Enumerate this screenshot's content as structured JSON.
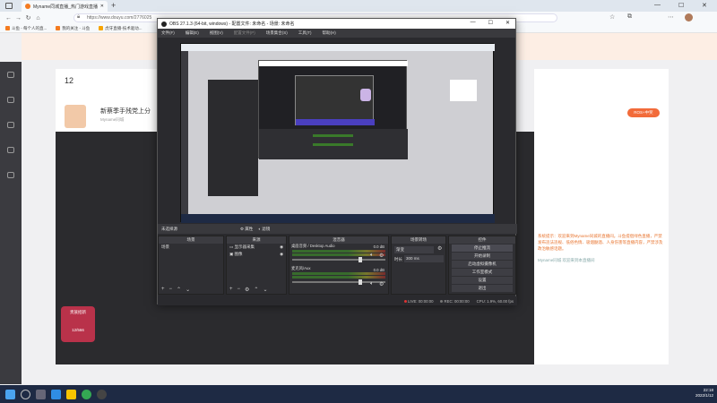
{
  "browser": {
    "tab_title": "Myname同城直播_热门游戏直播",
    "new_tab": "+",
    "address": "https://www.douyu.com/2776025",
    "favorites": [
      "斗鱼 - 每个人的直...",
      "我的关注 - 斗鱼",
      "虎牙直播-技术驱动..."
    ],
    "fav_colors": [
      "#f47b20",
      "#f47b20",
      "#f7a400"
    ]
  },
  "page": {
    "room_number": "12",
    "room_title": "新蔡季手残党上分",
    "host_name": "Myname同城",
    "follow_label": "+ 关注",
    "right_action": "ROS+中奖",
    "chat_notice": "系统提示：欢迎来到Myname同城的直播间。斗鱼提倡绿色直播，严禁发布违法违规、低俗色情、吸烟酗酒、人身伤害等直播内容，严禁涉及政治敏感话题。",
    "chat_user_line": "Myname同城 欢迎来到本直播间",
    "badge_title": "贵族招新",
    "badge_count": "12/566"
  },
  "obs": {
    "title": "OBS 27.1.3 (64-bit, windows) - 配置文件: 未命名 - 场景: 未命名",
    "menu": [
      "文件(F)",
      "编辑(E)",
      "视图(V)",
      "配置文件(P)",
      "场景集合(S)",
      "工具(T)",
      "帮助(H)"
    ],
    "source_bar": {
      "label": "未选择源",
      "properties": "属性",
      "filters": "滤镜"
    },
    "scenes": {
      "header": "场景",
      "items": [
        "场景"
      ]
    },
    "sources": {
      "header": "来源",
      "items": [
        "显示器采集",
        "图像"
      ]
    },
    "mixer": {
      "header": "混音器",
      "channels": [
        {
          "name": "桌面音频 / Desktop Audio",
          "db": "0.0 dB"
        },
        {
          "name": "麦克风/Aux",
          "db": "0.0 dB"
        }
      ]
    },
    "transitions": {
      "header": "场景转场",
      "type": "渐变",
      "duration_label": "时长",
      "duration": "300 ms"
    },
    "controls": {
      "header": "控件",
      "buttons": [
        "停止推流",
        "开始录制",
        "启动虚拟摄像机",
        "工作室模式",
        "设置",
        "退出"
      ]
    },
    "status": {
      "live": "LIVE: 00:00:00",
      "rec": "REC: 00:00:00",
      "cpu": "CPU: 1.9%, 60.00 fps"
    }
  },
  "taskbar": {
    "time": "22:18",
    "date": "2022/1/12"
  }
}
